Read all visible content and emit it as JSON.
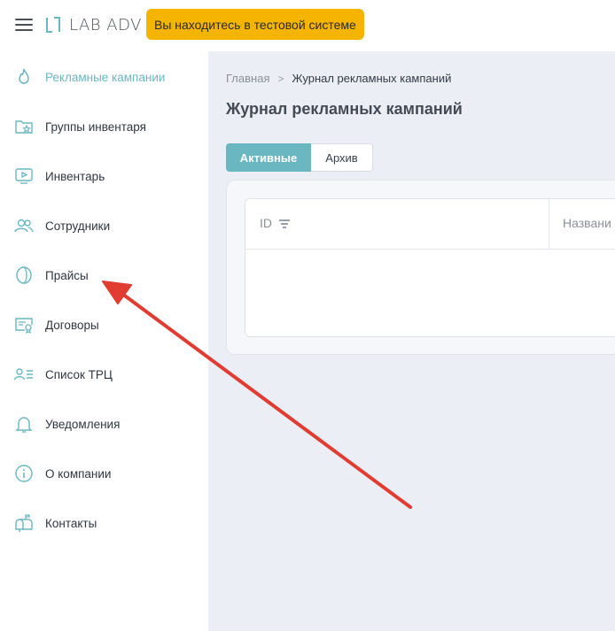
{
  "header": {
    "logo_text": "LAB ADV",
    "test_badge": "Вы находитесь в тестовой системе"
  },
  "sidebar": {
    "items": [
      {
        "label": "Рекламные кампании",
        "icon": "flame-icon",
        "active": true
      },
      {
        "label": "Группы инвентаря",
        "icon": "folder-star-icon",
        "active": false
      },
      {
        "label": "Инвентарь",
        "icon": "monitor-play-icon",
        "active": false
      },
      {
        "label": "Сотрудники",
        "icon": "users-icon",
        "active": false
      },
      {
        "label": "Прайсы",
        "icon": "coin-icon",
        "active": false
      },
      {
        "label": "Договоры",
        "icon": "certificate-icon",
        "active": false
      },
      {
        "label": "Список ТРЦ",
        "icon": "user-list-icon",
        "active": false
      },
      {
        "label": "Уведомления",
        "icon": "bell-icon",
        "active": false
      },
      {
        "label": "О компании",
        "icon": "info-icon",
        "active": false
      },
      {
        "label": "Контакты",
        "icon": "mailbox-icon",
        "active": false
      }
    ]
  },
  "breadcrumb": {
    "home": "Главная",
    "separator": ">",
    "current": "Журнал рекламных кампаний"
  },
  "page": {
    "title": "Журнал рекламных кампаний"
  },
  "tabs": {
    "active": "Активные",
    "archive": "Архив"
  },
  "table": {
    "columns": [
      "ID",
      "Названи"
    ]
  },
  "colors": {
    "accent": "#6ab7c1",
    "badge": "#f5b400",
    "main_bg": "#eceef5",
    "arrow": "#e03c31"
  }
}
